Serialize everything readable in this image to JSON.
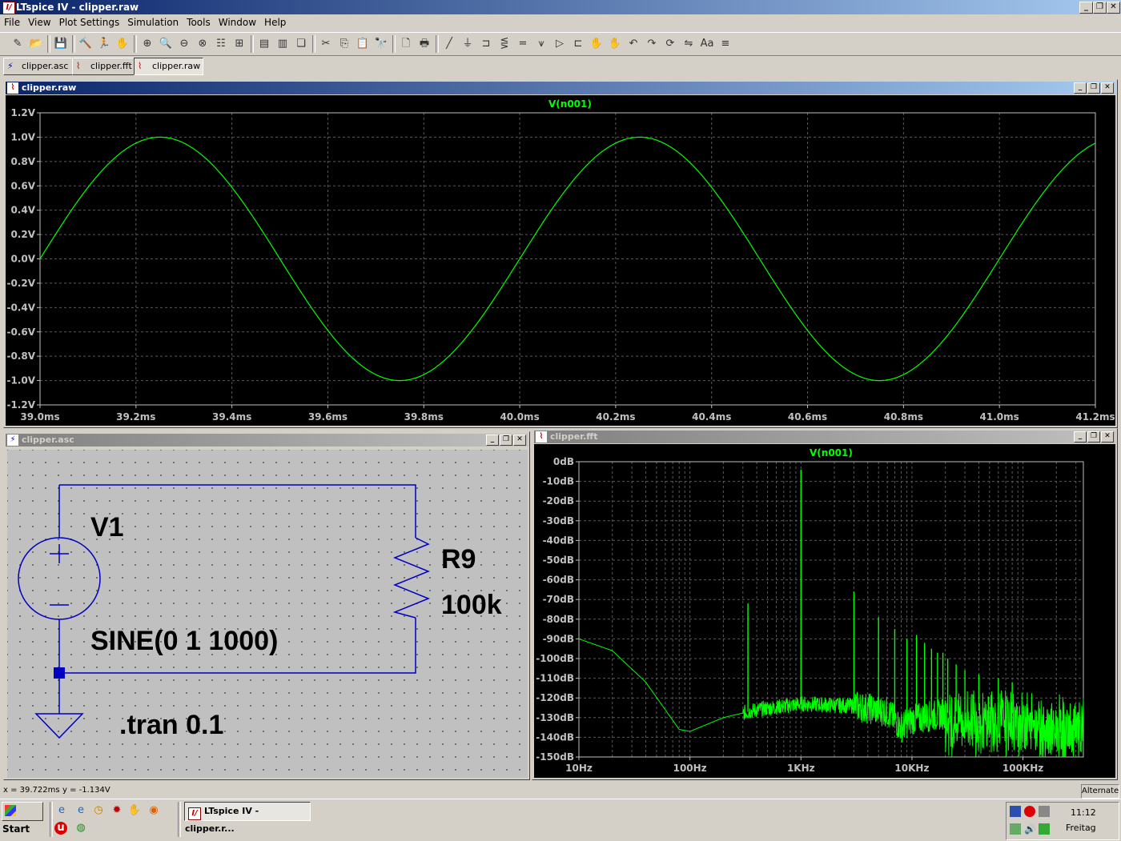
{
  "app": {
    "title": "LTspice IV - clipper.raw",
    "logo_glyph": "I/"
  },
  "window_controls": {
    "minimize": "_",
    "restore": "❐",
    "close": "✕"
  },
  "menu": {
    "items": [
      "File",
      "View",
      "Plot Settings",
      "Simulation",
      "Tools",
      "Window",
      "Help"
    ]
  },
  "toolbar": {
    "icons": [
      "new-schematic-icon",
      "open-icon",
      "save-icon",
      "control-panel-icon",
      "run-icon",
      "halt-icon",
      "zoom-in-icon",
      "zoom-area-icon",
      "zoom-out-icon",
      "zoom-fit-icon",
      "autorange-icon",
      "add-trace-icon",
      "tile-horizontal-icon",
      "tile-vertical-icon",
      "cascade-icon",
      "cut-icon",
      "copy-icon",
      "paste-icon",
      "find-icon",
      "print-preview-icon",
      "print-icon",
      "wire-icon",
      "ground-icon",
      "label-icon",
      "resistor-icon",
      "capacitor-icon",
      "inductor-icon",
      "diode-icon",
      "component-icon",
      "move-icon",
      "drag-icon",
      "undo-icon",
      "redo-icon",
      "rotate-icon",
      "mirror-icon",
      "text-icon",
      "spice-directive-icon"
    ],
    "glyphs": [
      "✎",
      "📂",
      "💾",
      "🔨",
      "🏃",
      "✋",
      "⊕",
      "🔍",
      "⊖",
      "⊗",
      "☷",
      "⊞",
      "▤",
      "▥",
      "❏",
      "✂",
      "⎘",
      "📋",
      "🔭",
      "🗋",
      "🖶",
      "╱",
      "⏚",
      "⊐",
      "⋚",
      "=",
      "⩛",
      "▷",
      "⊏",
      "✋",
      "✋",
      "↶",
      "↷",
      "⟳",
      "⇋",
      "Aa",
      "≡"
    ]
  },
  "tabs": [
    {
      "label": "clipper.asc",
      "icon": "schematic-icon",
      "glyph": "⚡"
    },
    {
      "label": "clipper.fft",
      "icon": "waveform-icon",
      "glyph": "⌇"
    },
    {
      "label": "clipper.raw",
      "icon": "waveform-icon",
      "glyph": "⌇"
    }
  ],
  "colors": {
    "trace": "#00ff00",
    "grid": "#5a5a5a",
    "wire": "#0000c0",
    "plot_bg": "#000000",
    "schematic_bg": "#c0c0c0"
  },
  "raw_window": {
    "title": "clipper.raw",
    "chart_data": {
      "type": "line",
      "title": "V(n001)",
      "series": [
        {
          "name": "V(n001)",
          "kind": "sine",
          "amplitude": 1.0,
          "frequency_hz": 1000,
          "offset": 0.0
        }
      ],
      "xlim_ms": [
        39.0,
        41.2
      ],
      "ylim": [
        -1.2,
        1.2
      ],
      "x_ticks": [
        "39.0ms",
        "39.2ms",
        "39.4ms",
        "39.6ms",
        "39.8ms",
        "40.0ms",
        "40.2ms",
        "40.4ms",
        "40.6ms",
        "40.8ms",
        "41.0ms",
        "41.2ms"
      ],
      "y_ticks": [
        "1.2V",
        "1.0V",
        "0.8V",
        "0.6V",
        "0.4V",
        "0.2V",
        "0.0V",
        "-0.2V",
        "-0.4V",
        "-0.6V",
        "-0.8V",
        "-1.0V",
        "-1.2V"
      ],
      "grid": true
    }
  },
  "asc_window": {
    "title": "clipper.asc",
    "labels": {
      "source_name": "V1",
      "source_value": "SINE(0 1 1000)",
      "resistor_name": "R9",
      "resistor_value": "100k",
      "directive": ".tran 0.1"
    }
  },
  "fft_window": {
    "title": "clipper.fft",
    "chart_data": {
      "type": "line",
      "title": "V(n001)",
      "x_scale": "log",
      "xlim_hz": [
        10,
        350000
      ],
      "ylim_db": [
        -150,
        0
      ],
      "x_ticks": [
        "10Hz",
        "100Hz",
        "1KHz",
        "10KHz",
        "100KHz"
      ],
      "y_ticks": [
        "0dB",
        "-10dB",
        "-20dB",
        "-30dB",
        "-40dB",
        "-50dB",
        "-60dB",
        "-70dB",
        "-80dB",
        "-90dB",
        "-100dB",
        "-110dB",
        "-120dB",
        "-130dB",
        "-140dB",
        "-150dB"
      ],
      "fundamental_hz": 1000,
      "fundamental_db": -4,
      "peaks": [
        [
          333,
          -72
        ],
        [
          1000,
          -4
        ],
        [
          3000,
          -66
        ],
        [
          5000,
          -79
        ],
        [
          7000,
          -85
        ],
        [
          9000,
          -90
        ],
        [
          11000,
          -88
        ],
        [
          13000,
          -92
        ],
        [
          15000,
          -95
        ],
        [
          17000,
          -97
        ],
        [
          19000,
          -97
        ],
        [
          21000,
          -100
        ],
        [
          25000,
          -103
        ],
        [
          30000,
          -106
        ],
        [
          40000,
          -108
        ],
        [
          60000,
          -110
        ],
        [
          80000,
          -112
        ]
      ],
      "noise_floor_db": [
        [
          10,
          -90
        ],
        [
          20,
          -96
        ],
        [
          40,
          -112
        ],
        [
          60,
          -126
        ],
        [
          80,
          -136
        ],
        [
          100,
          -137
        ],
        [
          200,
          -130
        ],
        [
          400,
          -126
        ],
        [
          1000,
          -123
        ],
        [
          3000,
          -124
        ],
        [
          6000,
          -127
        ],
        [
          8000,
          -135
        ],
        [
          10000,
          -131
        ],
        [
          30000,
          -126
        ],
        [
          100000,
          -128
        ],
        [
          300000,
          -133
        ]
      ],
      "grid": true
    }
  },
  "status": {
    "x_readout": "x = 39.722ms",
    "y_readout": "y = -1.134V",
    "mode": "Alternate"
  },
  "taskbar": {
    "start": "Start",
    "app_button": "LTspice IV - clipper.r...",
    "quicklaunch": [
      {
        "icon": "ie-icon",
        "glyph": "e"
      },
      {
        "icon": "explorer-icon",
        "glyph": "e"
      },
      {
        "icon": "clock-icon",
        "glyph": "◷"
      },
      {
        "icon": "gear-icon",
        "glyph": "✹"
      },
      {
        "icon": "hand-icon",
        "glyph": "✋"
      },
      {
        "icon": "firefox-icon",
        "glyph": "◉"
      },
      {
        "icon": "uninstall-icon",
        "glyph": "u"
      },
      {
        "icon": "chrome-icon",
        "glyph": "◍"
      }
    ],
    "clock_time": "11:12",
    "clock_day": "Freitag"
  }
}
